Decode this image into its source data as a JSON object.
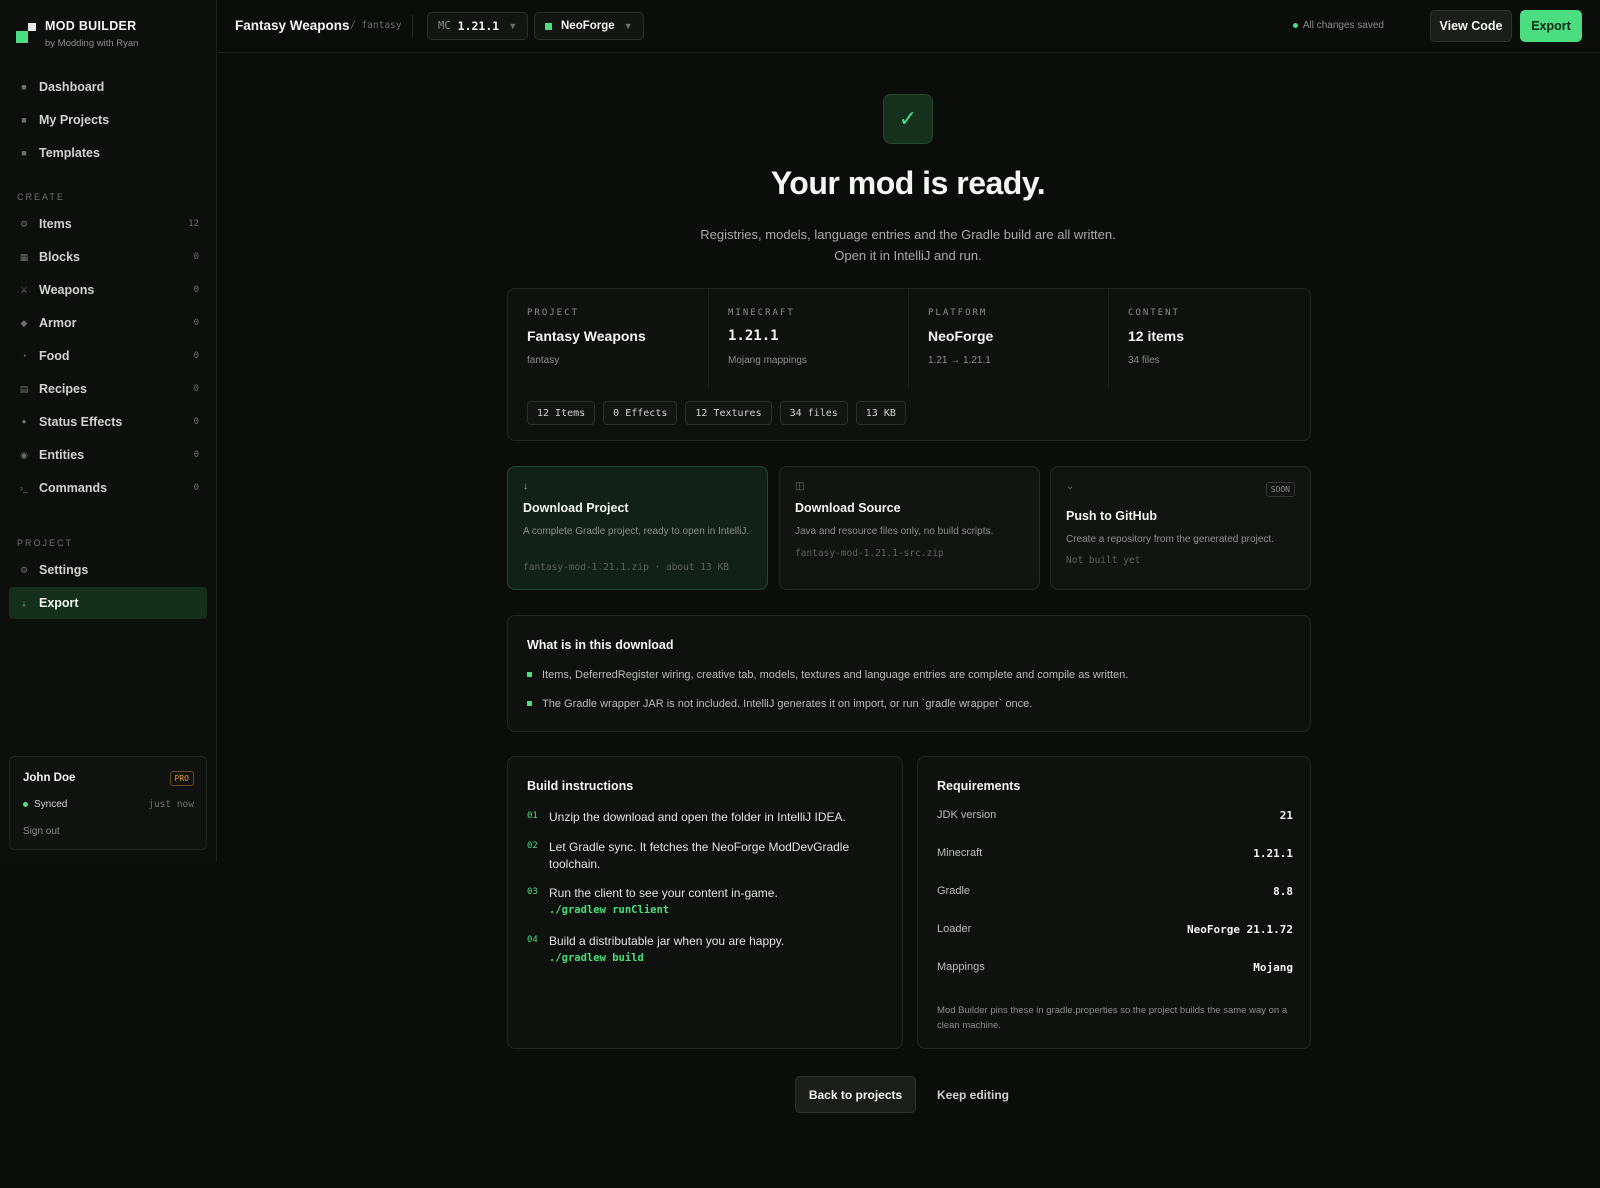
{
  "brand": {
    "title": "MOD BUILDER",
    "subtitle": "by Modding with Ryan"
  },
  "sidebar": {
    "top_items": [
      {
        "label": "Dashboard",
        "icon": "grid-icon"
      },
      {
        "label": "My Projects",
        "icon": "folder-icon"
      },
      {
        "label": "Templates",
        "icon": "template-icon"
      }
    ],
    "create_heading": "CREATE",
    "create_items": [
      {
        "label": "Items",
        "count": "12",
        "icon": "item-icon",
        "glyph": "⚙"
      },
      {
        "label": "Blocks",
        "count": "0",
        "icon": "block-icon",
        "glyph": "▦"
      },
      {
        "label": "Weapons",
        "count": "0",
        "icon": "sword-icon",
        "glyph": "⚔"
      },
      {
        "label": "Armor",
        "count": "0",
        "icon": "armor-icon",
        "glyph": "◆"
      },
      {
        "label": "Food",
        "count": "0",
        "icon": "food-icon",
        "glyph": "◔"
      },
      {
        "label": "Recipes",
        "count": "0",
        "icon": "recipe-icon",
        "glyph": "▤"
      },
      {
        "label": "Status Effects",
        "count": "0",
        "icon": "sparkle-icon",
        "glyph": "✦"
      },
      {
        "label": "Entities",
        "count": "0",
        "icon": "entity-icon",
        "glyph": "◉"
      },
      {
        "label": "Commands",
        "count": "0",
        "icon": "terminal-icon",
        "glyph": "›_"
      }
    ],
    "project_heading": "PROJECT",
    "project_items": [
      {
        "label": "Settings",
        "icon": "gear-icon",
        "glyph": "⚙"
      },
      {
        "label": "Export",
        "icon": "download-icon",
        "glyph": "↓"
      }
    ]
  },
  "user": {
    "name": "John Doe",
    "badge": "PRO",
    "status": "Synced",
    "sync_time": "just now",
    "signout": "Sign out"
  },
  "topbar": {
    "project_name": "Fantasy Weapons",
    "project_slug": "/ fantasy",
    "mc_prefix": "MC",
    "mc_version": "1.21.1",
    "platform": "NeoForge",
    "saved_status": "All changes saved",
    "view_code": "View Code",
    "export": "Export"
  },
  "hero": {
    "check": "✓",
    "title": "Your mod is ready.",
    "line1": "Registries, models, language entries and the Gradle build are all written.",
    "line2": "Open it in IntelliJ and run."
  },
  "summary": {
    "columns": [
      {
        "label": "PROJECT",
        "value": "Fantasy Weapons",
        "sub": "fantasy"
      },
      {
        "label": "MINECRAFT",
        "value": "1.21.1",
        "sub": "Mojang mappings"
      },
      {
        "label": "PLATFORM",
        "value": "NeoForge",
        "sub": "1.21 → 1.21.1"
      },
      {
        "label": "CONTENT",
        "value": "12 items",
        "sub": "34 files"
      }
    ],
    "chips": [
      "12 Items",
      "0 Effects",
      "12 Textures",
      "34 files",
      "13 KB"
    ]
  },
  "downloads": [
    {
      "icon": "download-icon",
      "glyph": "↓",
      "title": "Download Project",
      "desc": "A complete Gradle project, ready to open in IntelliJ.",
      "file": "fantasy-mod-1.21.1.zip · about 13 KB"
    },
    {
      "icon": "source-icon",
      "glyph": "◫",
      "title": "Download Source",
      "desc": "Java and resource files only, no build scripts.",
      "file": "fantasy-mod-1.21.1-src.zip"
    },
    {
      "icon": "github-icon",
      "glyph": "⌄",
      "title": "Push to GitHub",
      "desc": "Create a repository from the generated project.",
      "file": "Not built yet",
      "badge": "SOON"
    }
  ],
  "contents": {
    "title": "What is in this download",
    "bullets": [
      "Items, DeferredRegister wiring, creative tab, models, textures and language entries are complete and compile as written.",
      "The Gradle wrapper JAR is not included. IntelliJ generates it on import, or run `gradle wrapper` once."
    ]
  },
  "build": {
    "title": "Build instructions",
    "steps": [
      {
        "num": "01",
        "text": "Unzip the download and open the folder in IntelliJ IDEA.",
        "cmd": ""
      },
      {
        "num": "02",
        "text": "Let Gradle sync. It fetches the NeoForge ModDevGradle toolchain.",
        "cmd": ""
      },
      {
        "num": "03",
        "text": "Run the client to see your content in-game.",
        "cmd": "./gradlew runClient"
      },
      {
        "num": "04",
        "text": "Build a distributable jar when you are happy.",
        "cmd": "./gradlew build"
      }
    ]
  },
  "requirements": {
    "title": "Requirements",
    "rows": [
      {
        "key": "JDK version",
        "value": "21"
      },
      {
        "key": "Minecraft",
        "value": "1.21.1"
      },
      {
        "key": "Gradle",
        "value": "8.8"
      },
      {
        "key": "Loader",
        "value": "NeoForge 21.1.72"
      },
      {
        "key": "Mappings",
        "value": "Mojang"
      }
    ],
    "note": "Mod Builder pins these in gradle.properties so the project builds the same way on a clean machine."
  },
  "actions": {
    "back": "Back to projects",
    "keep": "Keep editing"
  },
  "colors": {
    "accent": "#4ade80",
    "background": "#0b0d0b",
    "badge_pro": "#e4a33b"
  }
}
